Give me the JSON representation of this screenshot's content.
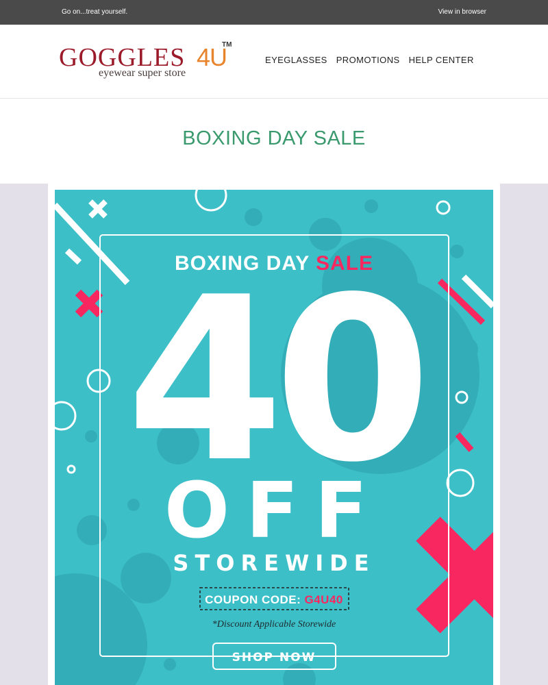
{
  "topbar": {
    "preheader": "Go on...treat yourself.",
    "view_in_browser": "View in browser"
  },
  "brand": {
    "name_word": "GOGGLES",
    "name_number": "4U",
    "trademark": "TM",
    "tagline": "eyewear super store"
  },
  "nav": {
    "items": [
      "EYEGLASSES",
      "PROMOTIONS",
      "HELP CENTER"
    ]
  },
  "page": {
    "title": "BOXING DAY SALE"
  },
  "banner": {
    "headline_main": "BOXING DAY ",
    "headline_accent": "SALE",
    "discount_value": "40",
    "off_label": "OFF",
    "scope": "STOREWIDE",
    "coupon_label": "COUPON CODE: ",
    "coupon_code": "G4U40",
    "disclaimer": "*Discount Applicable Storewide",
    "cta": "SHOP NOW"
  },
  "colors": {
    "teal": "#3dbfc8",
    "pink": "#f8275f",
    "green": "#3a9a6e",
    "brand_red": "#9b1b2a",
    "brand_orange": "#e8842c"
  },
  "icons": [
    "close-x-decoration-icon",
    "circle-ring-decoration-icon",
    "diagonal-stripe-decoration-icon"
  ]
}
